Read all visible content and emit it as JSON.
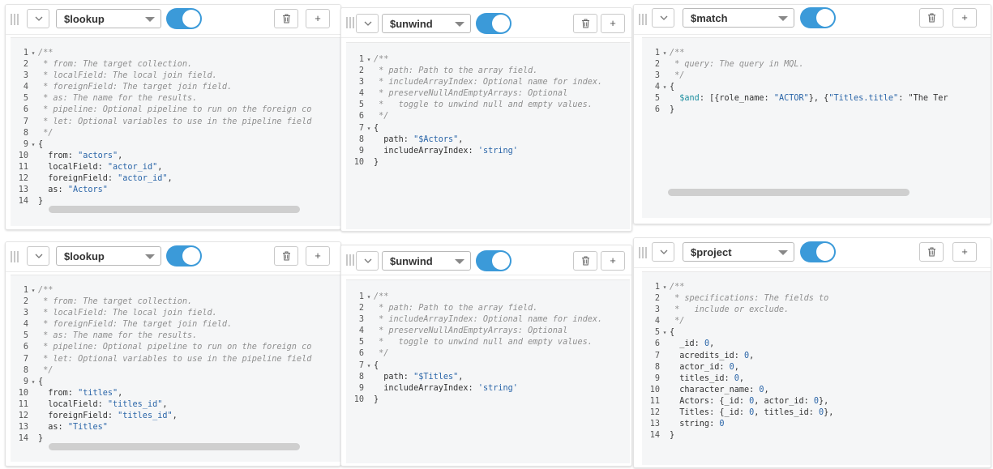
{
  "colors": {
    "toggle": "#3b9ad9",
    "string": "#2a65a8",
    "comment": "#8f8f8f",
    "operator": "#1d8fa0"
  },
  "icons": {
    "grip": "drag-handle-icon",
    "collapse": "chevron-down-icon",
    "delete": "trash-icon",
    "add": "plus-icon"
  },
  "add_label": "+",
  "stages": [
    {
      "operator": "$lookup",
      "enabled": true,
      "lines": [
        "/**",
        " * from: The target collection.",
        " * localField: The local join field.",
        " * foreignField: The target join field.",
        " * as: The name for the results.",
        " * pipeline: Optional pipeline to run on the foreign co",
        " * let: Optional variables to use in the pipeline field",
        " */",
        "{",
        "  from: \"actors\",",
        "  localField: \"actor_id\",",
        "  foreignField: \"actor_id\",",
        "  as: \"Actors\"",
        "}"
      ]
    },
    {
      "operator": "$unwind",
      "enabled": true,
      "lines": [
        "/**",
        " * path: Path to the array field.",
        " * includeArrayIndex: Optional name for index.",
        " * preserveNullAndEmptyArrays: Optional",
        " *   toggle to unwind null and empty values.",
        " */",
        "{",
        "  path: \"$Actors\",",
        "  includeArrayIndex: 'string'",
        "}"
      ]
    },
    {
      "operator": "$match",
      "enabled": true,
      "lines": [
        "/**",
        " * query: The query in MQL.",
        " */",
        "{",
        "  $and: [{role_name: \"ACTOR\"}, {\"Titles.title\": \"The Ter",
        "}"
      ]
    },
    {
      "operator": "$lookup",
      "enabled": true,
      "lines": [
        "/**",
        " * from: The target collection.",
        " * localField: The local join field.",
        " * foreignField: The target join field.",
        " * as: The name for the results.",
        " * pipeline: Optional pipeline to run on the foreign co",
        " * let: Optional variables to use in the pipeline field",
        " */",
        "{",
        "  from: \"titles\",",
        "  localField: \"titles_id\",",
        "  foreignField: \"titles_id\",",
        "  as: \"Titles\"",
        "}"
      ]
    },
    {
      "operator": "$unwind",
      "enabled": true,
      "lines": [
        "/**",
        " * path: Path to the array field.",
        " * includeArrayIndex: Optional name for index.",
        " * preserveNullAndEmptyArrays: Optional",
        " *   toggle to unwind null and empty values.",
        " */",
        "{",
        "  path: \"$Titles\",",
        "  includeArrayIndex: 'string'",
        "}"
      ]
    },
    {
      "operator": "$project",
      "enabled": true,
      "lines": [
        "/**",
        " * specifications: The fields to",
        " *   include or exclude.",
        " */",
        "{",
        "  _id: 0,",
        "  acredits_id: 0,",
        "  actor_id: 0,",
        "  titles_id: 0,",
        "  character_name: 0,",
        "  Actors: {_id: 0, actor_id: 0},",
        "  Titles: {_id: 0, titles_id: 0},",
        "  string: 0",
        "}"
      ]
    }
  ]
}
